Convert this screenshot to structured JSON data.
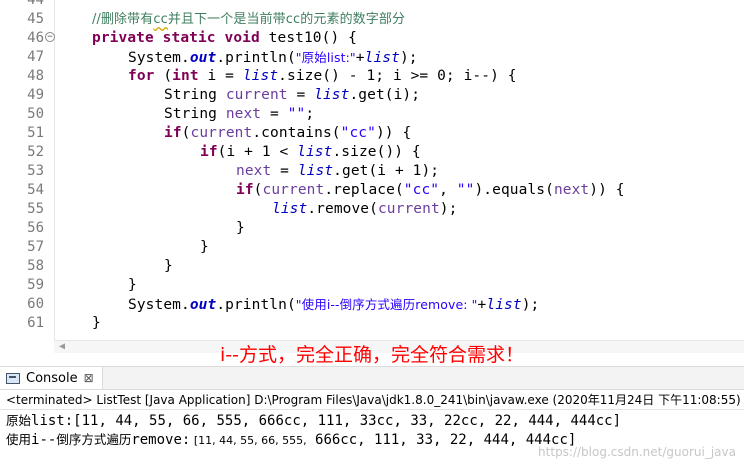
{
  "editor": {
    "top_partial_line_number": "44",
    "lines": [
      {
        "n": "45",
        "seg": [
          "//删除带有",
          "cc",
          "并且下一个是当前带cc的元素的数字部分"
        ]
      },
      {
        "n": "46",
        "seg": [
          "private",
          "static",
          "void",
          "test10() {"
        ]
      },
      {
        "n": "47",
        "seg": [
          "System.",
          "out",
          ".println(",
          "\"原始list:\"",
          "+",
          "list",
          ");"
        ]
      },
      {
        "n": "48",
        "seg": [
          "for",
          " (",
          "int",
          " i = ",
          "list",
          ".size() - 1; i >= 0; i--) {"
        ]
      },
      {
        "n": "49",
        "seg": [
          "String ",
          "current",
          " = ",
          "list",
          ".get(i);"
        ]
      },
      {
        "n": "50",
        "seg": [
          "String ",
          "next",
          " = ",
          "\"\"",
          ";"
        ]
      },
      {
        "n": "51",
        "seg": [
          "if",
          "(",
          "current",
          ".contains(",
          "\"cc\"",
          ")) {"
        ]
      },
      {
        "n": "52",
        "seg": [
          "if",
          "(i + 1 < ",
          "list",
          ".size()) {"
        ]
      },
      {
        "n": "53",
        "seg": [
          "next",
          " = ",
          "list",
          ".get(i + 1);"
        ]
      },
      {
        "n": "54",
        "seg": [
          "if",
          "(",
          "current",
          ".replace(",
          "\"cc\"",
          ", ",
          "\"\"",
          ").equals(",
          "next",
          ")) {"
        ]
      },
      {
        "n": "55",
        "seg": [
          "list",
          ".remove(",
          "current",
          ");"
        ]
      },
      {
        "n": "56",
        "seg": [
          "}"
        ]
      },
      {
        "n": "57",
        "seg": [
          "}"
        ]
      },
      {
        "n": "58",
        "seg": [
          "}"
        ]
      },
      {
        "n": "59",
        "seg": [
          "}"
        ]
      },
      {
        "n": "60",
        "seg": [
          "System.",
          "out",
          ".println(",
          "\"使用i--倒序方式遍历remove: \"",
          "+",
          "list",
          ");"
        ]
      },
      {
        "n": "61",
        "seg": [
          "}"
        ]
      }
    ]
  },
  "annotation": "i--方式，完全正确，完全符合需求！",
  "console": {
    "tab_label": "Console",
    "tab_close": "⊠",
    "status": "<terminated> ListTest [Java Application] D:\\Program Files\\Java\\jdk1.8.0_241\\bin\\javaw.exe (2020年11月24日 下午11:08:55)",
    "output": [
      {
        "prefix": "原始",
        "mid": "list:",
        "rest": "[11, 44, 55, 66, 555, 666cc, 111, 33cc, 33, 22cc, 22, 444, 444cc]"
      },
      {
        "prefix": "使用",
        "mid": "i--",
        "cn2": "倒序方式遍历",
        "mid2": "remove:",
        "small": " [11, 44, 55, 66, 555,",
        "rest": " 666cc, 111, 33, 22, 444, 444cc]"
      }
    ]
  },
  "watermark": "https://blog.csdn.net/guorui_java",
  "colors": {
    "keyword": "#7f0055",
    "comment": "#3f7f5f",
    "string": "#2a00ff",
    "field": "#0000c0",
    "annotation": "#ff0000"
  }
}
